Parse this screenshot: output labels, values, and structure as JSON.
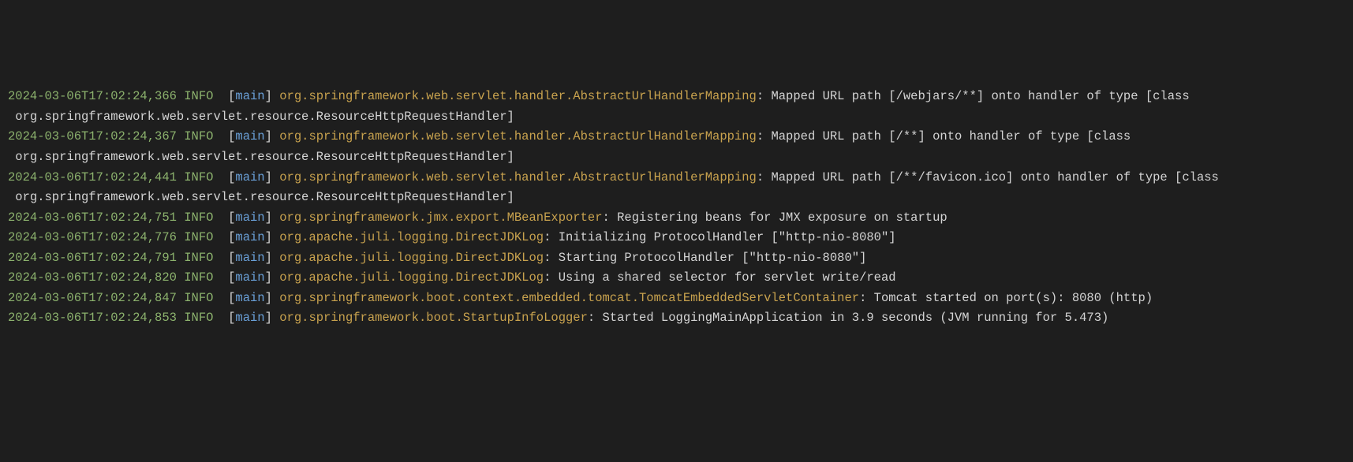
{
  "log": {
    "entries": [
      {
        "timestamp": "2024-03-06T17:02:24,366",
        "level": "INFO",
        "thread": "main",
        "logger": "org.springframework.web.servlet.handler.AbstractUrlHandlerMapping",
        "message": "Mapped URL path [/webjars/**] onto handler of type [class org.springframework.web.servlet.resource.ResourceHttpRequestHandler]"
      },
      {
        "timestamp": "2024-03-06T17:02:24,367",
        "level": "INFO",
        "thread": "main",
        "logger": "org.springframework.web.servlet.handler.AbstractUrlHandlerMapping",
        "message": "Mapped URL path [/**] onto handler of type [class org.springframework.web.servlet.resource.ResourceHttpRequestHandler]"
      },
      {
        "timestamp": "2024-03-06T17:02:24,441",
        "level": "INFO",
        "thread": "main",
        "logger": "org.springframework.web.servlet.handler.AbstractUrlHandlerMapping",
        "message": "Mapped URL path [/**/favicon.ico] onto handler of type [class org.springframework.web.servlet.resource.ResourceHttpRequestHandler]"
      },
      {
        "timestamp": "2024-03-06T17:02:24,751",
        "level": "INFO",
        "thread": "main",
        "logger": "org.springframework.jmx.export.MBeanExporter",
        "message": "Registering beans for JMX exposure on startup"
      },
      {
        "timestamp": "2024-03-06T17:02:24,776",
        "level": "INFO",
        "thread": "main",
        "logger": "org.apache.juli.logging.DirectJDKLog",
        "message": "Initializing ProtocolHandler [\"http-nio-8080\"]"
      },
      {
        "timestamp": "2024-03-06T17:02:24,791",
        "level": "INFO",
        "thread": "main",
        "logger": "org.apache.juli.logging.DirectJDKLog",
        "message": "Starting ProtocolHandler [\"http-nio-8080\"]"
      },
      {
        "timestamp": "2024-03-06T17:02:24,820",
        "level": "INFO",
        "thread": "main",
        "logger": "org.apache.juli.logging.DirectJDKLog",
        "message": "Using a shared selector for servlet write/read"
      },
      {
        "timestamp": "2024-03-06T17:02:24,847",
        "level": "INFO",
        "thread": "main",
        "logger": "org.springframework.boot.context.embedded.tomcat.TomcatEmbeddedServletContainer",
        "message": "Tomcat started on port(s): 8080 (http)"
      },
      {
        "timestamp": "2024-03-06T17:02:24,853",
        "level": "INFO",
        "thread": "main",
        "logger": "org.springframework.boot.StartupInfoLogger",
        "message": "Started LoggingMainApplication in 3.9 seconds (JVM running for 5.473)"
      }
    ]
  },
  "colors": {
    "background": "#1e1e1e",
    "timestamp": "#8cb26d",
    "level": "#8cb26d",
    "thread": "#6aa0d8",
    "logger": "#c8a24e",
    "message": "#d4d4d4"
  }
}
